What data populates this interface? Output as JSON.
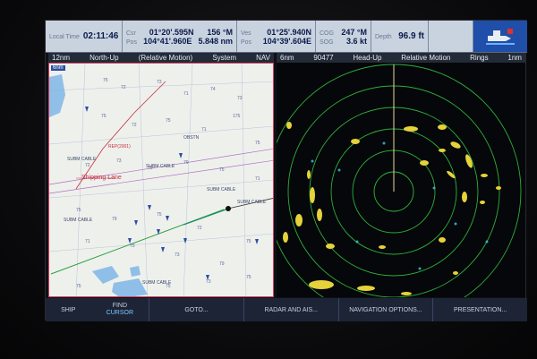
{
  "databar": {
    "local_time_label": "Local Time",
    "local_time": "02:11:46",
    "csr_label": "Csr",
    "csr_lat": "01°20'.595N",
    "csr_brg": "156 °M",
    "pos_label": "Pos",
    "csr_lon": "104°41'.960E",
    "csr_dist": "5.848 nm",
    "ves_label": "Ves",
    "ves_lat": "01°25'.940N",
    "ves_pos_label": "Pos",
    "ves_lon": "104°39'.604E",
    "cog_label": "COG",
    "cog": "247 °M",
    "sog_label": "SOG",
    "sog": "3.6 kt",
    "depth_label": "Depth",
    "depth": "96.9 ft"
  },
  "chart_header": {
    "range": "12nm",
    "orientation": "North-Up",
    "motion": "(Relative Motion)",
    "system": "System",
    "mode": "NAV"
  },
  "radar_header": {
    "range": "6nm",
    "id": "90477",
    "orientation": "Head-Up",
    "motion": "Relative Motion",
    "rings": "Rings",
    "ring_spacing": "1nm"
  },
  "chart": {
    "scale_tag": "6nm",
    "labels": {
      "shipping_lane": "Shipping Lane",
      "subm_cable": "SUBM CABLE",
      "obstn": "OBSTN",
      "rep": "REP(2001)"
    }
  },
  "softkeys": {
    "ship": "SHIP",
    "find": "FIND",
    "cursor": "CURSOR",
    "goto": "GOTO...",
    "radar_ais": "RADAR AND AIS...",
    "nav_options": "NAVIGATION OPTIONS...",
    "presentation": "PRESENTATION..."
  },
  "colors": {
    "chart_bg": "#eef0ec",
    "radar_echo": "#e6d23a",
    "radar_ring": "#2fae3a",
    "heading_line": "#e8d8a0",
    "active_key": "#7ec8ff"
  }
}
